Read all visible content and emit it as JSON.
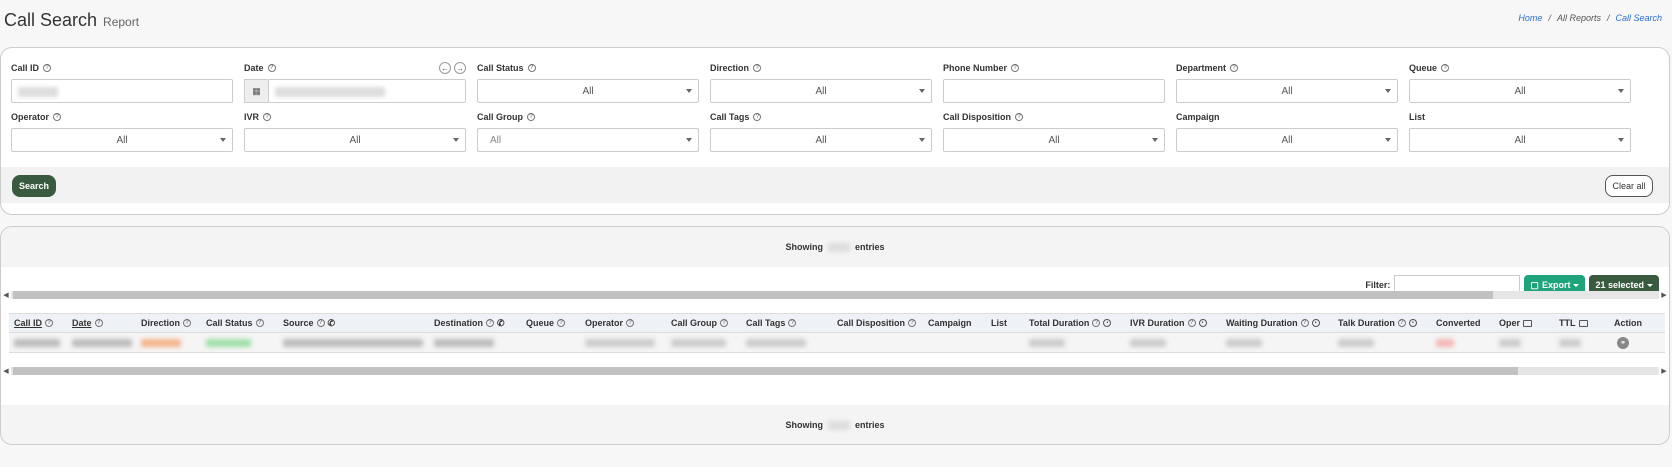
{
  "page": {
    "title": "Call Search",
    "subtitle": "Report"
  },
  "breadcrumb": {
    "home": "Home",
    "sep1": "/",
    "reports": "All Reports",
    "sep2": "/",
    "current": "Call Search"
  },
  "filters": {
    "call_id": {
      "label": "Call ID",
      "value": ""
    },
    "date": {
      "label": "Date",
      "value": ""
    },
    "call_status": {
      "label": "Call Status",
      "value": "All"
    },
    "direction": {
      "label": "Direction",
      "value": "All"
    },
    "phone_number": {
      "label": "Phone Number",
      "value": ""
    },
    "department": {
      "label": "Department",
      "value": "All"
    },
    "queue": {
      "label": "Queue",
      "value": "All"
    },
    "operator": {
      "label": "Operator",
      "value": "All"
    },
    "ivr": {
      "label": "IVR",
      "value": "All"
    },
    "call_group": {
      "label": "Call Group",
      "value": "All"
    },
    "call_tags": {
      "label": "Call Tags",
      "value": "All"
    },
    "call_disposition": {
      "label": "Call Disposition",
      "value": "All"
    },
    "campaign": {
      "label": "Campaign",
      "value": "All"
    },
    "list": {
      "label": "List",
      "value": "All"
    }
  },
  "actions": {
    "search": "Search",
    "clear_all": "Clear all"
  },
  "results": {
    "showing_prefix": "Showing",
    "showing_suffix": "entries",
    "filter_label": "Filter:",
    "export_label": "Export",
    "selected_label": "21 selected",
    "columns": {
      "call_id": "Call ID",
      "date": "Date",
      "direction": "Direction",
      "call_status": "Call Status",
      "source": "Source",
      "destination": "Destination",
      "queue": "Queue",
      "operator": "Operator",
      "call_group": "Call Group",
      "call_tags": "Call Tags",
      "call_disposition": "Call Disposition",
      "campaign": "Campaign",
      "list": "List",
      "total_duration": "Total Duration",
      "ivr_duration": "IVR Duration",
      "waiting_duration": "Waiting Duration",
      "talk_duration": "Talk Duration",
      "converted": "Converted",
      "oper": "Oper",
      "ttl": "TTL",
      "action": "Action"
    }
  },
  "colors": {
    "primary": "#3a5a40",
    "export": "#1fa37a",
    "link": "#2a6fd6"
  }
}
